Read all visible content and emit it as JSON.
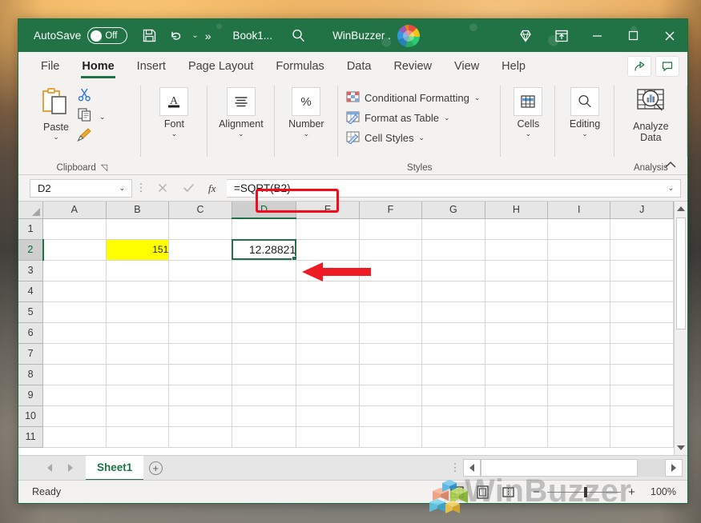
{
  "titlebar": {
    "autosave_label": "AutoSave",
    "autosave_state": "Off",
    "save_icon": "save-icon",
    "undo_icon": "undo-icon",
    "undo_caret": "⌄",
    "more_commands": "»",
    "document_title": "Book1...",
    "search_icon": "search-icon",
    "account_name": "WinBuzzer .",
    "avatar": "user-avatar",
    "diamond_icon": "diamond-icon",
    "ribbon_display_icon": "ribbon-display-options-icon",
    "minimize": "−",
    "maximize": "▢",
    "close": "✕"
  },
  "ribbon": {
    "tabs": [
      {
        "label": "File",
        "active": false
      },
      {
        "label": "Home",
        "active": true
      },
      {
        "label": "Insert",
        "active": false
      },
      {
        "label": "Page Layout",
        "active": false
      },
      {
        "label": "Formulas",
        "active": false
      },
      {
        "label": "Data",
        "active": false
      },
      {
        "label": "Review",
        "active": false
      },
      {
        "label": "View",
        "active": false
      },
      {
        "label": "Help",
        "active": false
      }
    ],
    "share_icon": "share-icon",
    "comments_icon": "comments-icon",
    "collapse_icon": "collapse-ribbon-chevron-icon",
    "groups": {
      "clipboard": {
        "name": "Clipboard",
        "paste_label": "Paste",
        "paste_caret": "⌄",
        "cut_icon": "cut-scissors-icon",
        "copy_icon": "copy-icon",
        "copy_caret": "⌄",
        "format_painter_icon": "format-painter-icon",
        "dialog_launcher": "◹"
      },
      "font": {
        "name": "",
        "label": "Font",
        "caret": "⌄",
        "icon": "font-A-icon"
      },
      "alignment": {
        "name": "",
        "label": "Alignment",
        "caret": "⌄",
        "icon": "alignment-lines-icon"
      },
      "number": {
        "name": "",
        "label": "Number",
        "caret": "⌄",
        "icon": "percent-icon"
      },
      "styles": {
        "name": "Styles",
        "items": [
          {
            "label": "Conditional Formatting",
            "caret": "⌄",
            "icon": "conditional-formatting-icon"
          },
          {
            "label": "Format as Table",
            "caret": "⌄",
            "icon": "format-as-table-icon"
          },
          {
            "label": "Cell Styles",
            "caret": "⌄",
            "icon": "cell-styles-icon"
          }
        ]
      },
      "cells": {
        "name": "",
        "label": "Cells",
        "caret": "⌄",
        "icon": "cells-table-icon"
      },
      "editing": {
        "name": "",
        "label": "Editing",
        "caret": "⌄",
        "icon": "editing-search-icon"
      },
      "analysis": {
        "name": "Analysis",
        "label": "Analyze Data",
        "icon": "analyze-data-icon"
      }
    }
  },
  "formula_bar": {
    "name_box_value": "D2",
    "name_box_caret": "⌄",
    "options_dots": "⋮",
    "cancel_icon": "cancel-x-icon",
    "enter_icon": "enter-check-icon",
    "function_icon": "insert-function-fx-icon",
    "formula_value": "=SQRT(B2)",
    "expand_caret": "⌄",
    "highlight_color": "#f5091b"
  },
  "grid": {
    "columns": [
      "A",
      "B",
      "C",
      "D",
      "E",
      "F",
      "G",
      "H",
      "I",
      "J"
    ],
    "selected_column": "D",
    "rows": [
      "1",
      "2",
      "3",
      "4",
      "5",
      "6",
      "7",
      "8",
      "9",
      "10",
      "11"
    ],
    "selected_row": "2",
    "active_cell": "D2",
    "cells": [
      {
        "ref": "B2",
        "value": "151",
        "style": "highlight-yellow"
      },
      {
        "ref": "D2",
        "value": "12.28821",
        "style": "active"
      }
    ],
    "annotation": {
      "type": "red-arrow",
      "points_to": "D2",
      "color": "#ee1b24"
    }
  },
  "sheetbar": {
    "prev_icon": "prev-sheet-arrow-icon",
    "next_icon": "next-sheet-arrow-icon",
    "tabs": [
      {
        "label": "Sheet1",
        "active": true
      }
    ],
    "add_sheet_icon": "add-sheet-plus-icon",
    "options_dots": "⋮"
  },
  "statusbar": {
    "status": "Ready",
    "normal_view_icon": "normal-view-icon",
    "page_layout_icon": "page-layout-view-icon",
    "page_break_icon": "page-break-preview-icon",
    "zoom_out": "−",
    "zoom_in": "+",
    "zoom_level": "100%"
  },
  "watermark": {
    "text": "WinBuzzer"
  },
  "theme": {
    "excel_green": "#217346",
    "ribbon_bg": "#f3f2f1",
    "grid_line": "#d6d6d6",
    "header_bg": "#e6e6e6",
    "highlight_yellow": "#ffff00",
    "annotation_red": "#ee1b24"
  }
}
